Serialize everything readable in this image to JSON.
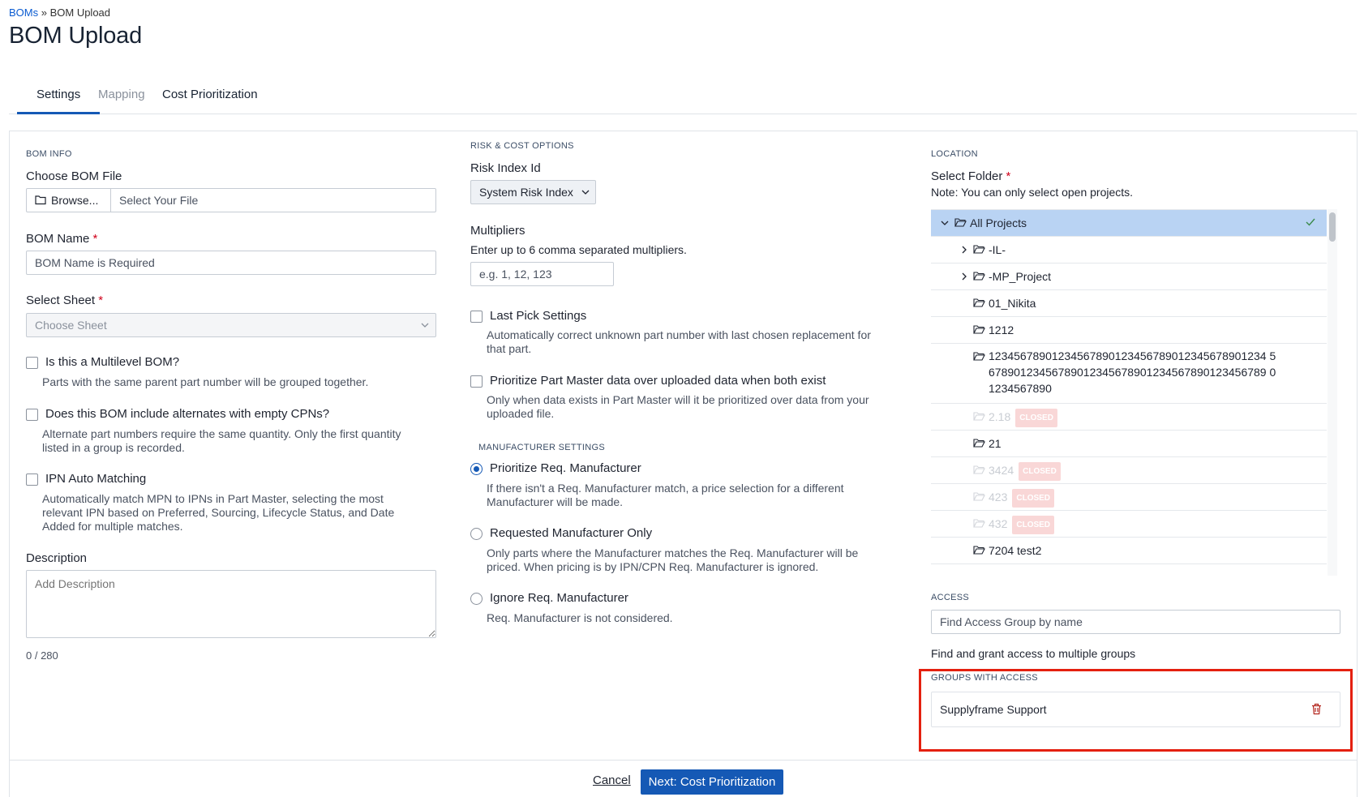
{
  "breadcrumb": {
    "link": "BOMs",
    "separator": " » ",
    "current": "BOM Upload"
  },
  "page_title": "BOM Upload",
  "tabs": [
    {
      "label": "Settings",
      "state": "active"
    },
    {
      "label": "Mapping",
      "state": "disabled"
    },
    {
      "label": "Cost Prioritization",
      "state": "normal"
    }
  ],
  "bom_info": {
    "section": "BOM INFO",
    "file_label": "Choose BOM File",
    "browse_label": "Browse...",
    "file_placeholder": "Select Your File",
    "name_label": "BOM Name",
    "name_placeholder": "BOM Name is Required",
    "sheet_label": "Select Sheet",
    "sheet_placeholder": "Choose Sheet",
    "required_mark": "*",
    "multilevel_label": "Is this a Multilevel BOM?",
    "multilevel_help": "Parts with the same parent part number will be grouped together.",
    "alternates_label": "Does this BOM include alternates with empty CPNs?",
    "alternates_help_1": "Alternate part numbers require the same quantity. Only the first quantity",
    "alternates_help_2": "listed in a group is recorded.",
    "ipn_label": "IPN Auto Matching",
    "ipn_help_1": "Automatically match MPN to IPNs in Part Master, selecting the most",
    "ipn_help_2": "relevant IPN based on Preferred, Sourcing, Lifecycle Status, and Date",
    "ipn_help_3": "Added for multiple matches.",
    "description_label": "Description",
    "description_placeholder": "Add Description",
    "char_count": "0 / 280"
  },
  "risk_cost": {
    "section": "RISK & COST OPTIONS",
    "risk_label": "Risk Index Id",
    "risk_value": "System Risk Index",
    "multipliers_label": "Multipliers",
    "multipliers_help": "Enter up to 6 comma separated multipliers.",
    "multipliers_placeholder": "e.g. 1, 12, 123",
    "last_pick_label": "Last Pick Settings",
    "last_pick_help_1": "Automatically correct unknown part number with last chosen replacement for",
    "last_pick_help_2": "that part.",
    "part_master_label": "Prioritize Part Master data over uploaded data when both exist",
    "part_master_help_1": "Only when data exists in Part Master will it be prioritized over data from your",
    "part_master_help_2": "uploaded file.",
    "manufacturer_section": "MANUFACTURER SETTINGS",
    "opt1_label": "Prioritize Req. Manufacturer",
    "opt1_help_1": "If there isn't a Req. Manufacturer match, a price selection for a different",
    "opt1_help_2": "Manufacturer will be made.",
    "opt2_label": "Requested Manufacturer Only",
    "opt2_help_1": "Only parts where the Manufacturer matches the Req. Manufacturer will be",
    "opt2_help_2": "priced. When pricing is by IPN/CPN Req. Manufacturer is ignored.",
    "opt3_label": "Ignore Req. Manufacturer",
    "opt3_help": "Req. Manufacturer is not considered.",
    "selected_option": "Prioritize Req. Manufacturer"
  },
  "location": {
    "section": "LOCATION",
    "folder_label": "Select Folder",
    "folder_note": "Note: You can only select open projects.",
    "tree": [
      {
        "name": "All Projects",
        "selected": true,
        "expandable": true,
        "closed": false
      },
      {
        "name": "-IL-",
        "selected": false,
        "expandable": true,
        "closed": false
      },
      {
        "name": "-MP_Project",
        "selected": false,
        "expandable": true,
        "closed": false
      },
      {
        "name": "01_Nikita",
        "selected": false,
        "expandable": false,
        "closed": false
      },
      {
        "name": "1212",
        "selected": false,
        "expandable": false,
        "closed": false
      },
      {
        "name": "1234567890123456789012345678901234567890123456789012345678901234567890123456789012345678901234567890",
        "name_line1": "12345678901234567890123456789012345678901234 5",
        "name_line2": "67890123456789012345678901234567890123456789 0",
        "name_line3": "1234567890",
        "selected": false,
        "expandable": false,
        "closed": false
      },
      {
        "name": "2.18",
        "selected": false,
        "expandable": false,
        "closed": true
      },
      {
        "name": "21",
        "selected": false,
        "expandable": false,
        "closed": false
      },
      {
        "name": "3424",
        "selected": false,
        "expandable": false,
        "closed": true
      },
      {
        "name": "423",
        "selected": false,
        "expandable": false,
        "closed": true
      },
      {
        "name": "432",
        "selected": false,
        "expandable": false,
        "closed": true
      },
      {
        "name": "7204 test2",
        "selected": false,
        "expandable": false,
        "closed": false
      }
    ],
    "closed_badge": "CLOSED"
  },
  "access": {
    "section": "ACCESS",
    "search_placeholder": "Find Access Group by name",
    "help": "Find and grant access to multiple groups",
    "groups_section": "GROUPS WITH ACCESS",
    "groups": [
      {
        "name": "Supplyframe Support"
      }
    ]
  },
  "footer": {
    "cancel_label": "Cancel",
    "next_label": "Next: Cost Prioritization"
  },
  "colors": {
    "primary": "#1559b5",
    "selected_row": "#b9d3f3",
    "highlight": "#e4200f",
    "closed_badge": "#f9d7d7"
  }
}
